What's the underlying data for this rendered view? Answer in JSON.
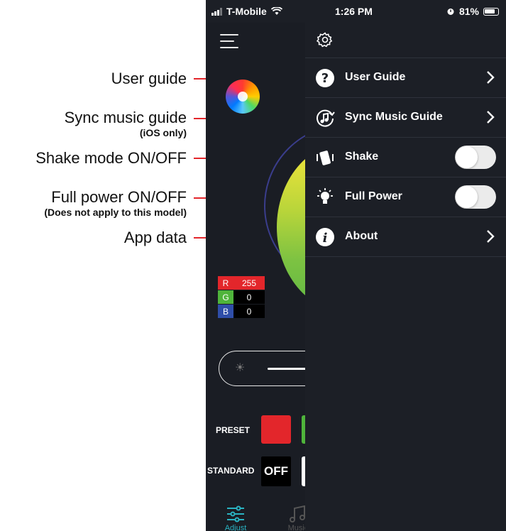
{
  "annotations": [
    {
      "main": "User guide",
      "sub": ""
    },
    {
      "main": "Sync music guide",
      "sub": "(iOS only)"
    },
    {
      "main": "Shake mode ON/OFF",
      "sub": ""
    },
    {
      "main": "Full power ON/OFF",
      "sub": "(Does not apply to this model)"
    },
    {
      "main": "App data",
      "sub": ""
    }
  ],
  "status_bar": {
    "carrier": "T-Mobile",
    "time": "1:26 PM",
    "battery": "81%"
  },
  "drawer": {
    "items": [
      {
        "label": "User Guide",
        "icon": "question-circle-icon",
        "control": "chevron"
      },
      {
        "label": "Sync Music Guide",
        "icon": "music-sync-icon",
        "control": "chevron"
      },
      {
        "label": "Shake",
        "icon": "shake-phone-icon",
        "control": "toggle",
        "toggle_on": false
      },
      {
        "label": "Full Power",
        "icon": "lightbulb-icon",
        "control": "toggle",
        "toggle_on": false
      },
      {
        "label": "About",
        "icon": "info-circle-icon",
        "control": "chevron"
      }
    ]
  },
  "background_app": {
    "rgb": {
      "r_label": "R",
      "r": "255",
      "g_label": "G",
      "g": "0",
      "b_label": "B",
      "b": "0"
    },
    "preset_label": "PRESET",
    "standard_label": "STANDARD",
    "off_label": "OFF",
    "tabs": {
      "adjust": "Adjust",
      "music": "Music"
    }
  },
  "colors": {
    "accent_red": "#e3262b",
    "drawer_bg": "#1c1f26",
    "tab_active": "#2ab3c2"
  }
}
